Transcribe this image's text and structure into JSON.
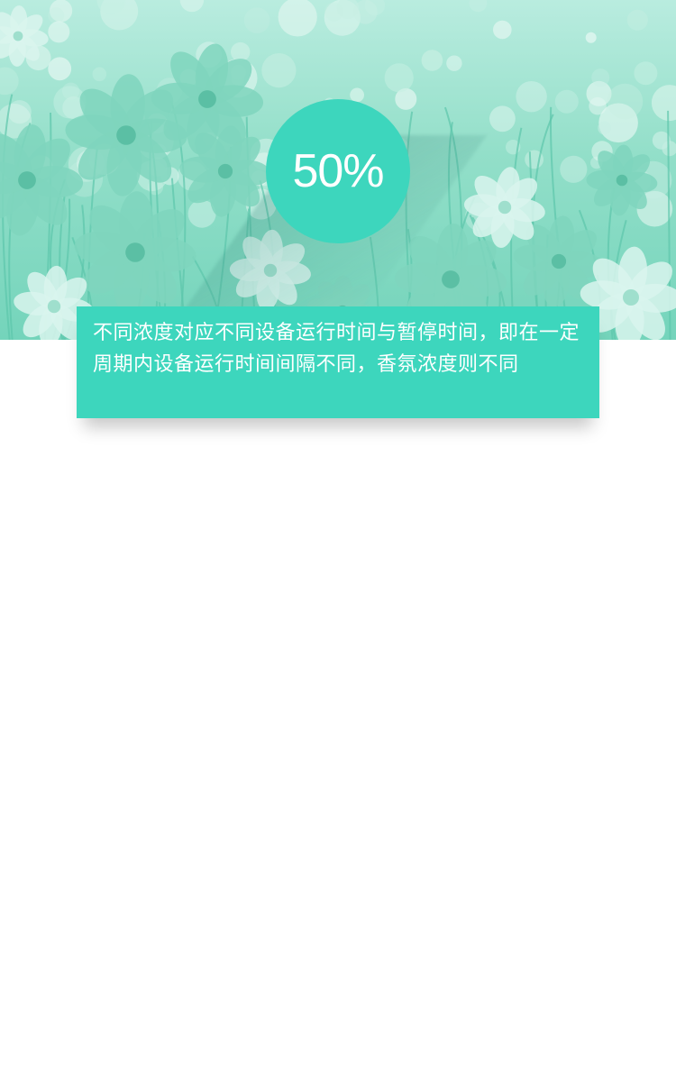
{
  "hero": {
    "image": "flower-field-photo",
    "badge_value": "50%"
  },
  "card": {
    "text": "不同浓度对应不同设备运行时间与暂停时间，即在一定周期内设备运行时间间隔不同，香氛浓度则不同"
  },
  "colors": {
    "accent": "#3dd6bd",
    "hero_tint": "#8fdcc6",
    "text": "#ffffff",
    "background": "#ffffff"
  }
}
